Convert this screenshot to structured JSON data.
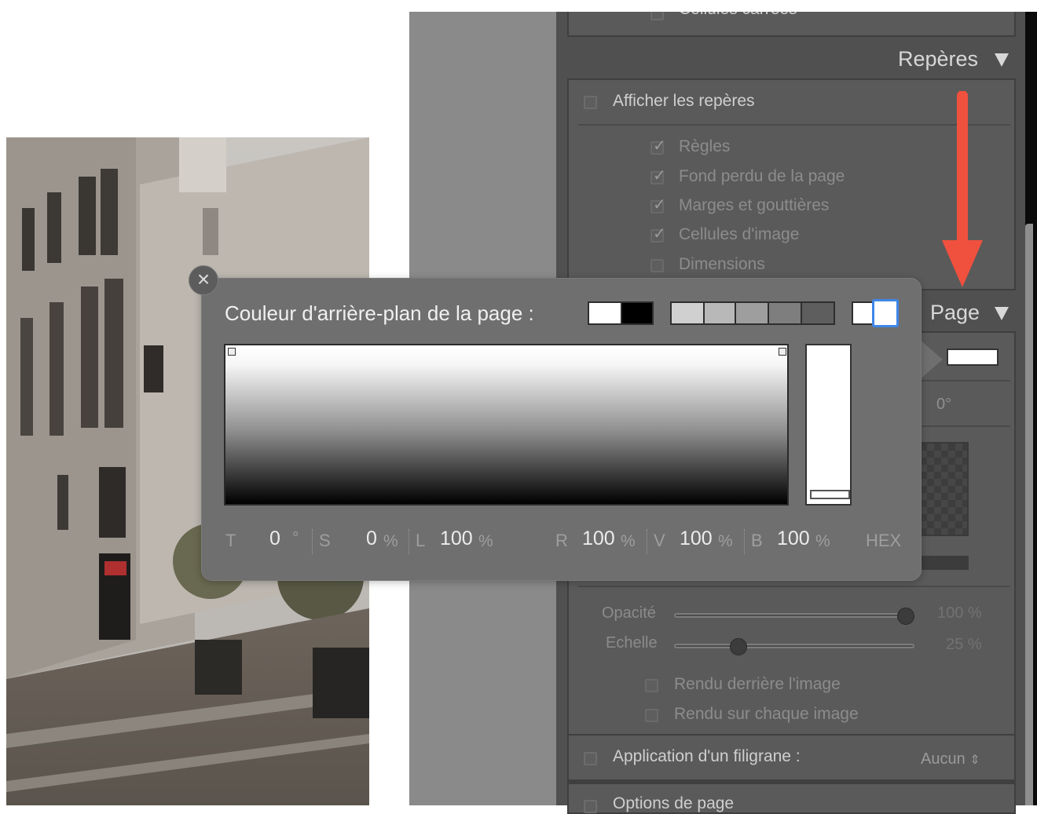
{
  "panel": {
    "top_partial_label": "Cellules carrées",
    "reperes_header": "Repères",
    "afficher_reperes": {
      "label": "Afficher les repères",
      "checked": false
    },
    "guide_options": [
      {
        "label": "Règles",
        "checked": true
      },
      {
        "label": "Fond perdu de la page",
        "checked": true
      },
      {
        "label": "Marges et gouttières",
        "checked": true
      },
      {
        "label": "Cellules d'image",
        "checked": true
      },
      {
        "label": "Dimensions",
        "checked": false
      }
    ],
    "page_header": "Page",
    "angle_value": "0°",
    "sliders": [
      {
        "label": "Opacité",
        "value": 100,
        "unit": "%"
      },
      {
        "label": "Echelle",
        "value": 25,
        "unit": "%"
      }
    ],
    "render_options": [
      {
        "label": "Rendu derrière l'image",
        "checked": false
      },
      {
        "label": "Rendu sur chaque image",
        "checked": false
      }
    ],
    "watermark": {
      "label": "Application d'un filigrane :",
      "value": "Aucun",
      "checked": false
    },
    "bottom_partial_label": "Options de page"
  },
  "color_popup": {
    "title": "Couleur d'arrière-plan de la page :",
    "close_glyph": "×",
    "preset_swatches": [
      "#ffffff",
      "#000000"
    ],
    "gray_swatches": [
      "#d0d0d0",
      "#b8b8b8",
      "#9e9e9e",
      "#7e7e7e",
      "#5e5e5e"
    ],
    "current_swatches": [
      "#ffffff",
      "#ffffff"
    ],
    "fields": {
      "T": {
        "label": "T",
        "value": "0",
        "unit": "°"
      },
      "S": {
        "label": "S",
        "value": "0",
        "unit": "%"
      },
      "L": {
        "label": "L",
        "value": "100",
        "unit": "%"
      },
      "R": {
        "label": "R",
        "value": "100",
        "unit": "%"
      },
      "V": {
        "label": "V",
        "value": "100",
        "unit": "%"
      },
      "B": {
        "label": "B",
        "value": "100",
        "unit": "%"
      },
      "HEX": {
        "label": "HEX"
      }
    }
  },
  "colors": {
    "annotation_arrow": "#f0503e",
    "panel": "#505050",
    "popup": "#6f6f6f"
  }
}
